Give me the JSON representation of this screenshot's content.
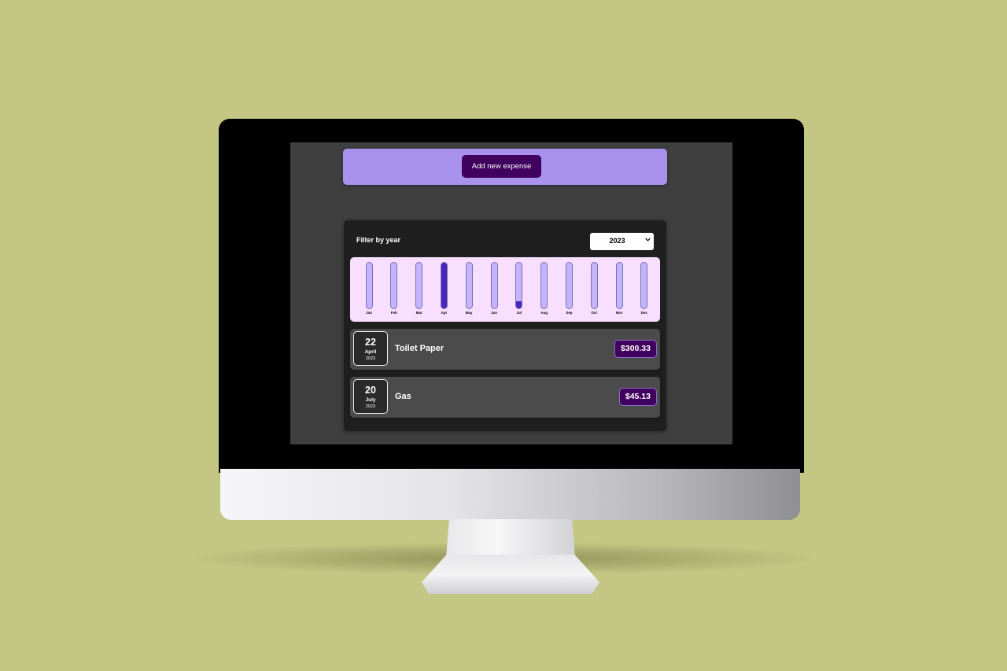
{
  "new_expense": {
    "button_label": "Add new expense"
  },
  "filter": {
    "label": "Filter by year",
    "selected_year": "2023"
  },
  "chart_data": {
    "type": "bar",
    "categories": [
      "Jan",
      "Feb",
      "Mar",
      "Apr",
      "May",
      "Jun",
      "Jul",
      "Aug",
      "Sep",
      "Oct",
      "Nov",
      "Dec"
    ],
    "values": [
      0,
      0,
      0,
      300.33,
      0,
      0,
      45.13,
      0,
      0,
      0,
      0,
      0
    ],
    "max_value": 300.33
  },
  "expenses": [
    {
      "day": "22",
      "month": "April",
      "year": "2023",
      "title": "Toilet Paper",
      "amount": "$300.33"
    },
    {
      "day": "20",
      "month": "July",
      "year": "2023",
      "title": "Gas",
      "amount": "$45.13"
    }
  ],
  "colors": {
    "background": "#c4c783",
    "accent": "#a892ee",
    "button": "#40005d",
    "chart_bg": "#f8dfff",
    "bar_track": "#c3b4fc",
    "bar_fill": "#4826b9",
    "card": "#1f1f1f",
    "item": "#4b4b4b"
  }
}
